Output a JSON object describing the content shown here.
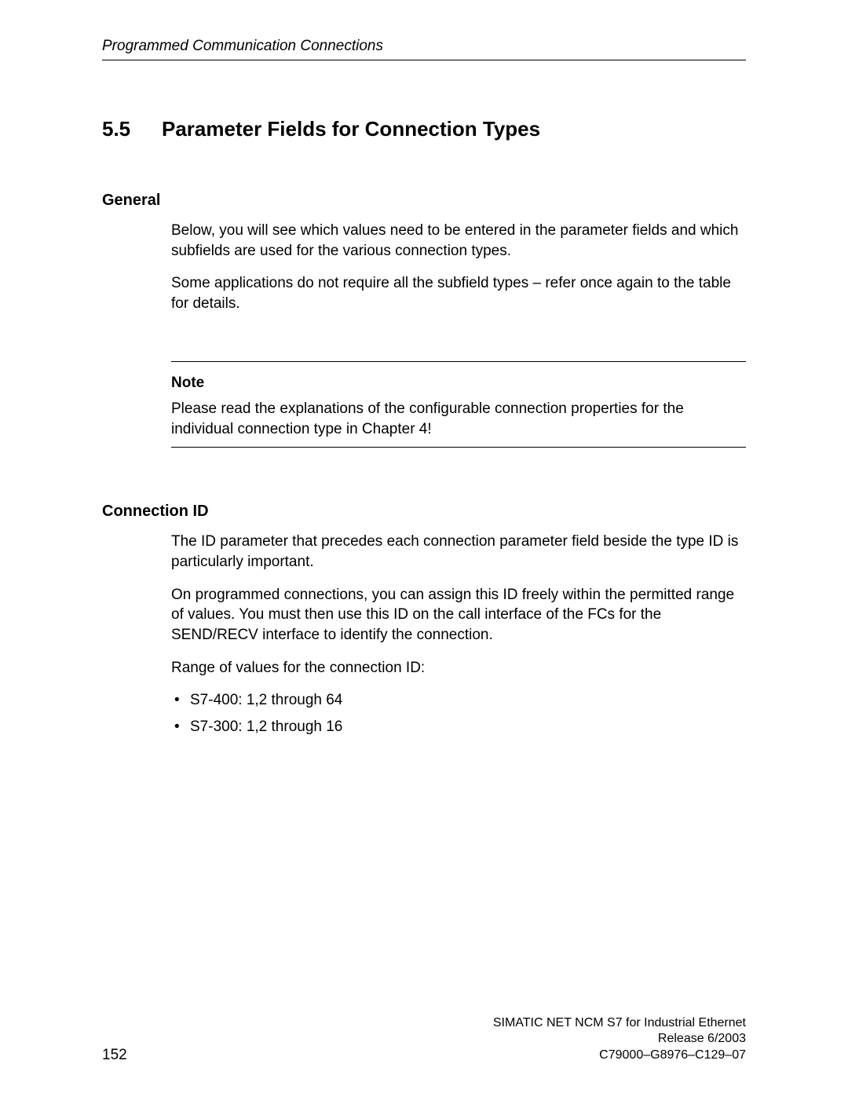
{
  "header": {
    "running_title": "Programmed Communication Connections"
  },
  "section": {
    "number": "5.5",
    "title": "Parameter Fields for Connection Types"
  },
  "general": {
    "heading": "General",
    "p1": "Below, you will see which values need to be entered in the parameter fields and which subfields are used for the various connection types.",
    "p2": "Some applications do not require all the subfield types – refer once again to the table for details."
  },
  "note": {
    "label": "Note",
    "text": "Please read the explanations of the configurable connection properties for the individual connection type in Chapter 4!"
  },
  "connection_id": {
    "heading": "Connection ID",
    "p1": "The ID parameter that precedes each connection parameter field beside the type ID is particularly important.",
    "p2": "On programmed connections, you can assign this ID freely within the permitted range of values. You must then use this ID on the call interface of the FCs for the SEND/RECV interface to identify the connection.",
    "p3": "Range of values for the connection ID:",
    "bullets": [
      "S7-400: 1,2 through 64",
      "S7-300: 1,2 through 16"
    ]
  },
  "footer": {
    "page": "152",
    "line1": "SIMATIC NET NCM S7 for Industrial Ethernet",
    "line2": "Release 6/2003",
    "line3": "C79000–G8976–C129–07"
  }
}
